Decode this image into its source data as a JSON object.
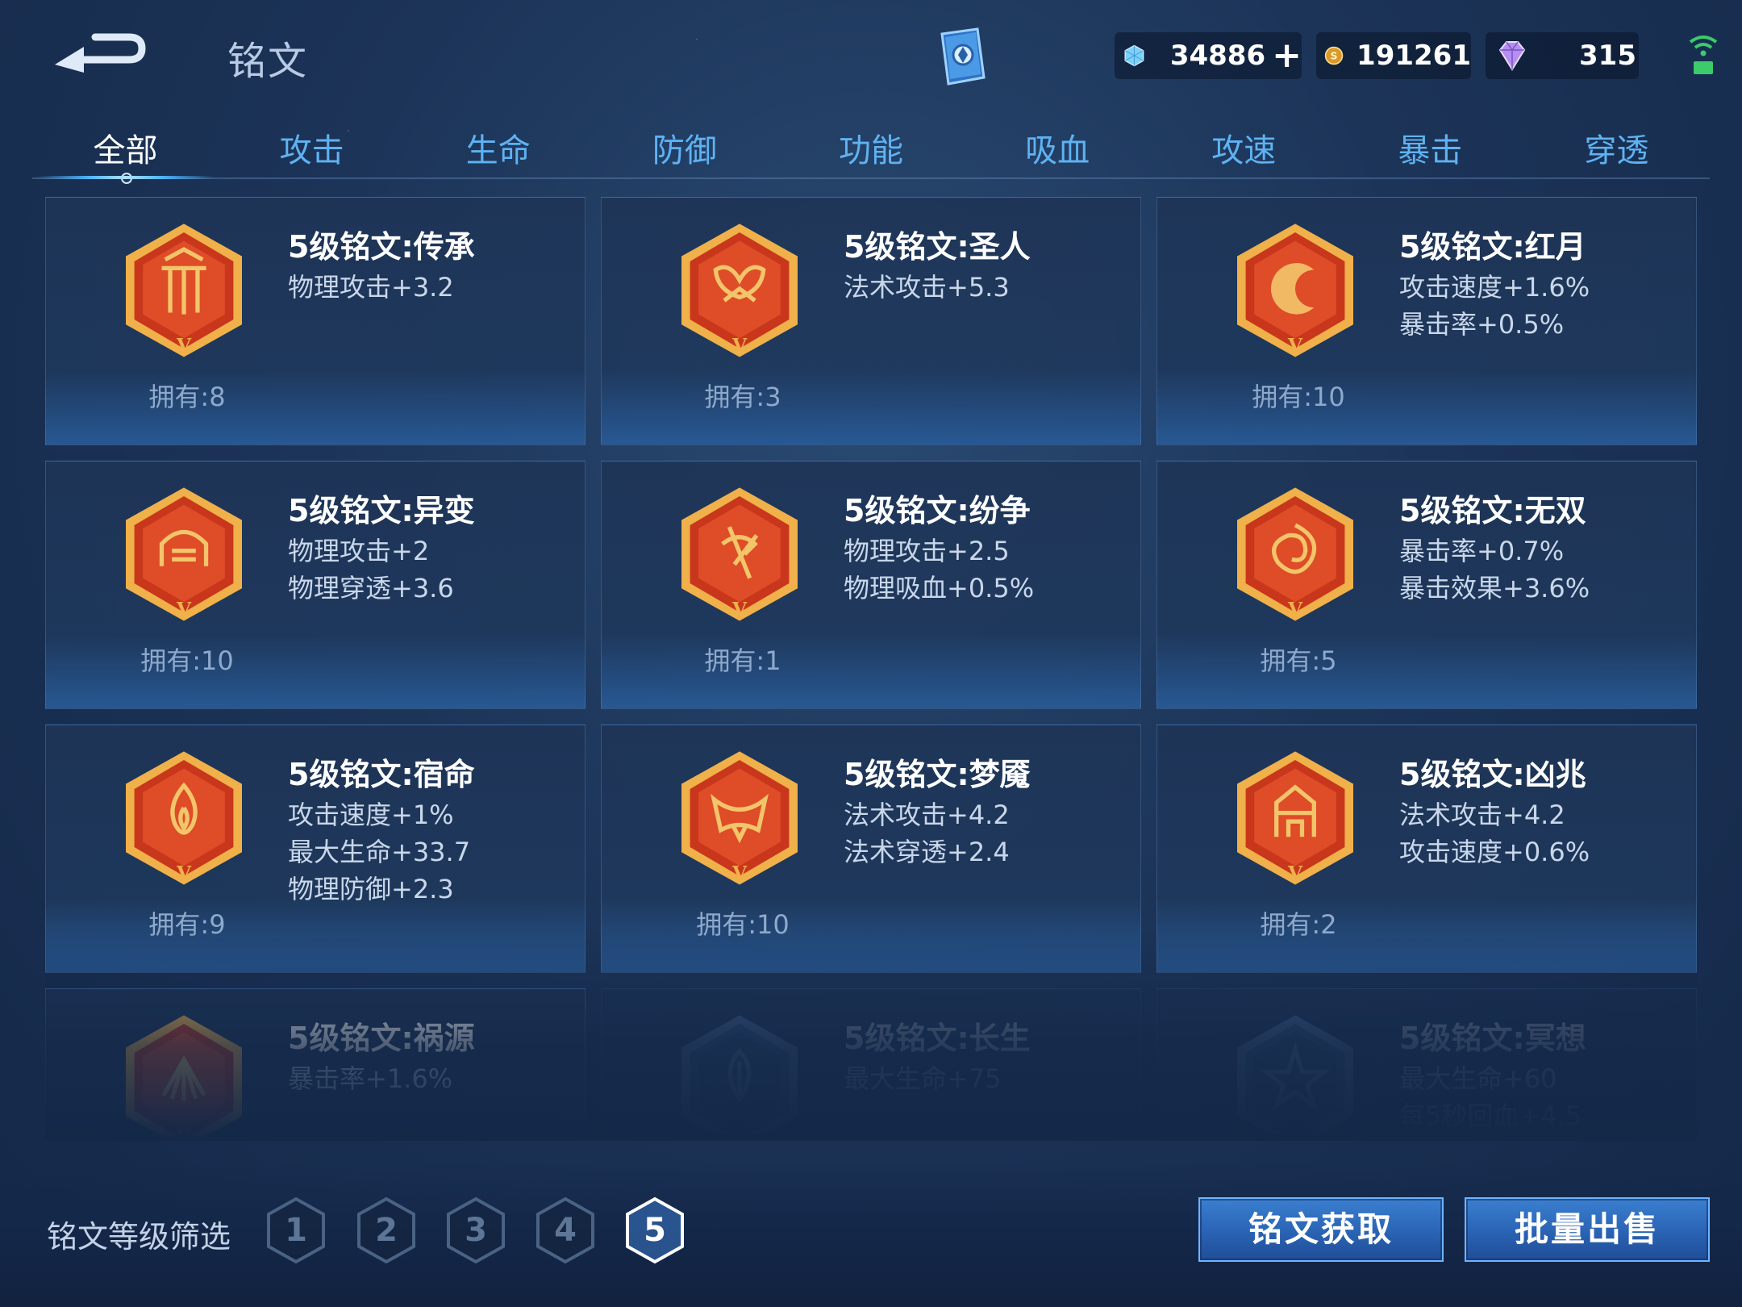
{
  "header": {
    "title": "铭文",
    "currencies": [
      {
        "icon": "diamond-crystal-icon",
        "amount": "34886"
      },
      {
        "icon": "gold-coin-icon",
        "amount": "191261"
      },
      {
        "icon": "purple-gem-icon",
        "amount": "315"
      }
    ],
    "add_label": "+"
  },
  "tabs": [
    "全部",
    "攻击",
    "生命",
    "防御",
    "功能",
    "吸血",
    "攻速",
    "暴击",
    "穿透"
  ],
  "active_tab": "全部",
  "cards": [
    {
      "name": "5级铭文:传承",
      "attrs": [
        "物理攻击+3.2"
      ],
      "owned": "拥有:8",
      "icon": "pillars-rune-icon"
    },
    {
      "name": "5级铭文:圣人",
      "attrs": [
        "法术攻击+5.3"
      ],
      "owned": "拥有:3",
      "icon": "butterfly-rune-icon"
    },
    {
      "name": "5级铭文:红月",
      "attrs": [
        "攻击速度+1.6%",
        "暴击率+0.5%"
      ],
      "owned": "拥有:10",
      "icon": "crescent-moon-rune-icon"
    },
    {
      "name": "5级铭文:异变",
      "attrs": [
        "物理攻击+2",
        "物理穿透+3.6"
      ],
      "owned": "拥有:10",
      "icon": "mask-rune-icon"
    },
    {
      "name": "5级铭文:纷争",
      "attrs": [
        "物理攻击+2.5",
        "物理吸血+0.5%"
      ],
      "owned": "拥有:1",
      "icon": "axe-rune-icon"
    },
    {
      "name": "5级铭文:无双",
      "attrs": [
        "暴击率+0.7%",
        "暴击效果+3.6%"
      ],
      "owned": "拥有:5",
      "icon": "vortex-rune-icon"
    },
    {
      "name": "5级铭文:宿命",
      "attrs": [
        "攻击速度+1%",
        "最大生命+33.7",
        "物理防御+2.3"
      ],
      "owned": "拥有:9",
      "icon": "flame-rune-icon"
    },
    {
      "name": "5级铭文:梦魇",
      "attrs": [
        "法术攻击+4.2",
        "法术穿透+2.4"
      ],
      "owned": "拥有:10",
      "icon": "bat-rune-icon"
    },
    {
      "name": "5级铭文:凶兆",
      "attrs": [
        "法术攻击+4.2",
        "攻击速度+0.6%"
      ],
      "owned": "拥有:2",
      "icon": "gate-rune-icon"
    },
    {
      "name": "5级铭文:祸源",
      "attrs": [
        "暴击率+1.6%"
      ],
      "owned": "",
      "icon": "fan-rune-icon"
    },
    {
      "name": "5级铭文:长生",
      "attrs": [
        "最大生命+75"
      ],
      "owned": "",
      "icon": "leaf-rune-icon"
    },
    {
      "name": "5级铭文:冥想",
      "attrs": [
        "最大生命+60",
        "每5秒回血+4.5"
      ],
      "owned": "",
      "icon": "star-rune-icon"
    }
  ],
  "filter": {
    "label": "铭文等级筛选",
    "levels": [
      "1",
      "2",
      "3",
      "4",
      "5"
    ],
    "active": "5"
  },
  "buttons": {
    "obtain": "铭文获取",
    "sell": "批量出售"
  },
  "colors": {
    "tab_inactive": "#5fb2f2",
    "rune_red": "#c8361c",
    "rune_gold": "#f0b04a",
    "button_blue": "#2a63b4"
  }
}
